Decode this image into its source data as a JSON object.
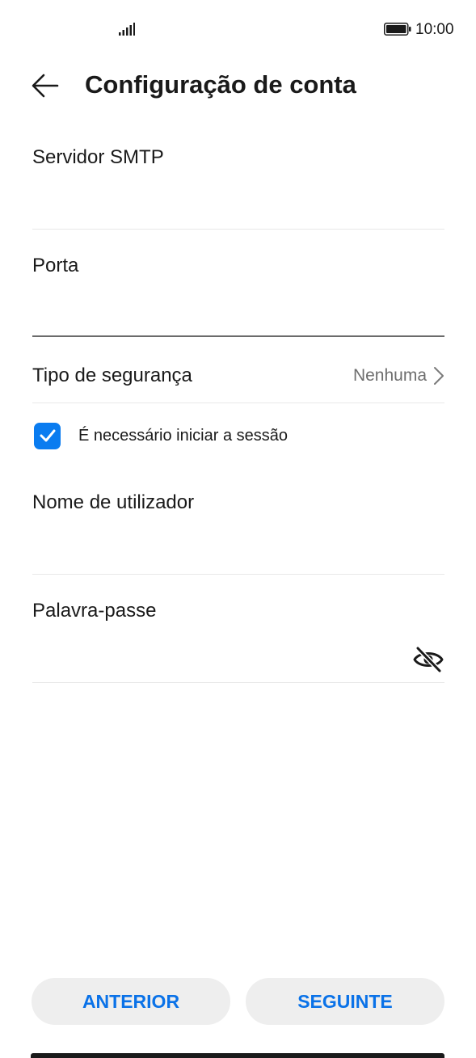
{
  "status_bar": {
    "time": "10:00",
    "signal_icon": "signal-icon",
    "battery_icon": "battery-icon"
  },
  "header": {
    "title": "Configuração de conta",
    "back_icon": "arrow-left-icon"
  },
  "form": {
    "smtp_server": {
      "label": "Servidor SMTP",
      "value": ""
    },
    "port": {
      "label": "Porta",
      "value": ""
    },
    "security_type": {
      "label": "Tipo de segurança",
      "value": "Nenhuma",
      "icon": "chevron-right-icon"
    },
    "login_required": {
      "label": "É necessário iniciar a sessão",
      "checked": true
    },
    "username": {
      "label": "Nome de utilizador",
      "value": ""
    },
    "password": {
      "label": "Palavra-passe",
      "value": "",
      "toggle_icon": "eye-off-icon"
    }
  },
  "footer": {
    "previous_label": "ANTERIOR",
    "next_label": "SEGUINTE"
  },
  "colors": {
    "accent": "#0a7cf0",
    "button_text": "#0a72e8",
    "button_bg": "#eeeeee",
    "secondary_text": "#6e6e6e"
  }
}
